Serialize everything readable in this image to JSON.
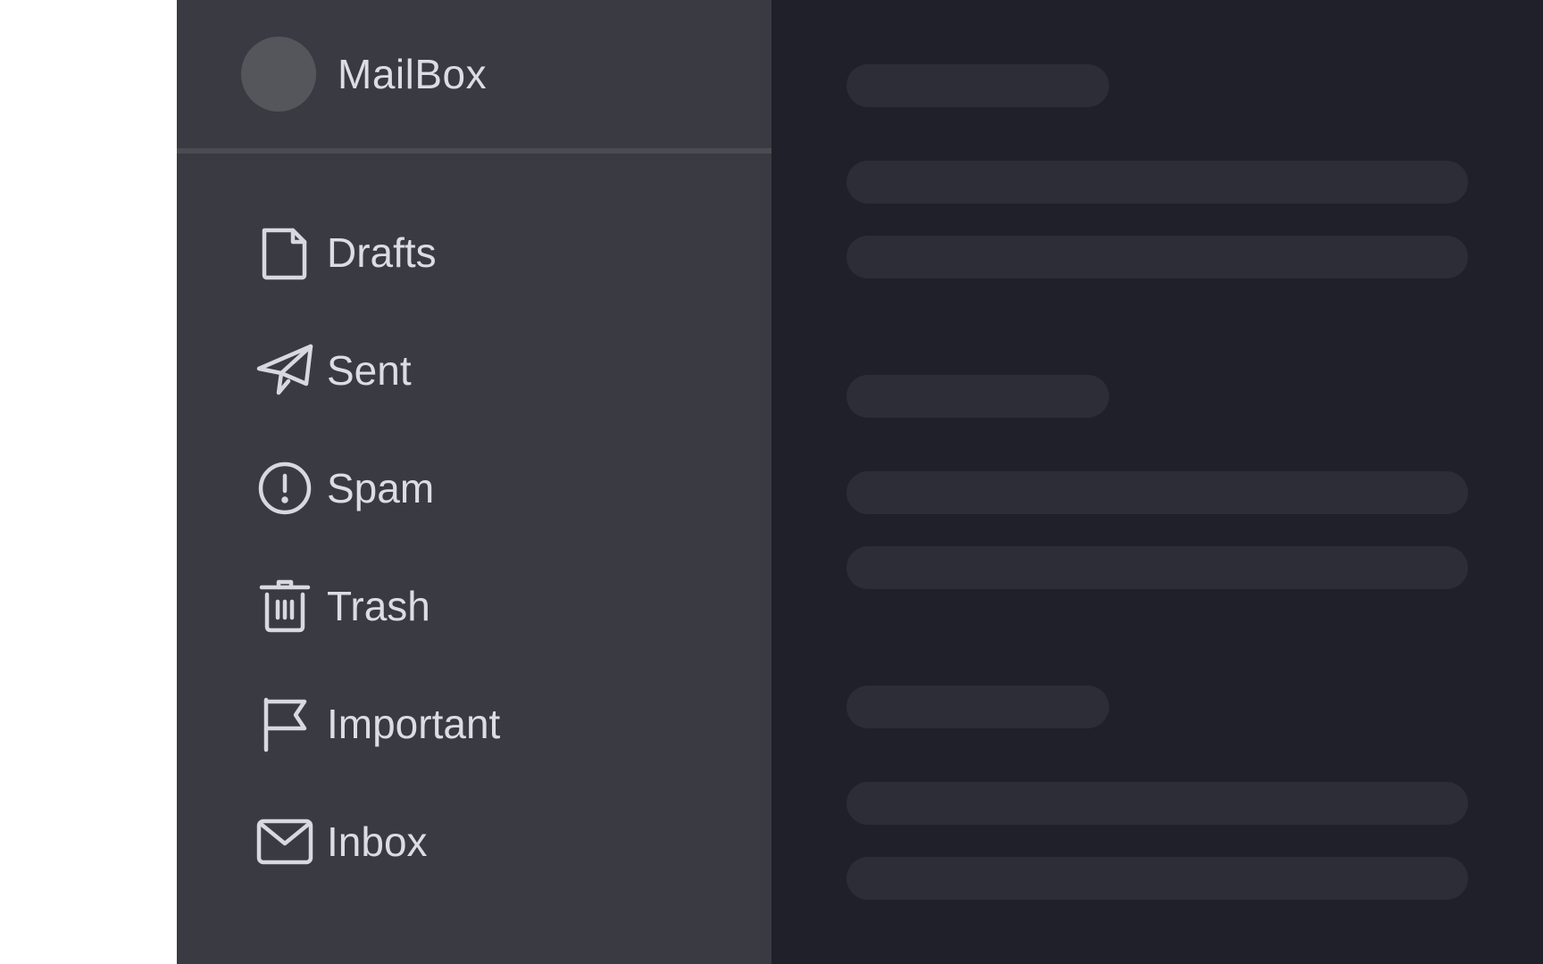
{
  "app": {
    "name": "MailBox"
  },
  "sidebar": {
    "items": [
      {
        "label": "Drafts",
        "icon": "file-icon"
      },
      {
        "label": "Sent",
        "icon": "paper-plane-icon"
      },
      {
        "label": "Spam",
        "icon": "alert-circle-icon"
      },
      {
        "label": "Trash",
        "icon": "trash-icon"
      },
      {
        "label": "Important",
        "icon": "flag-icon"
      },
      {
        "label": "Inbox",
        "icon": "mail-icon"
      }
    ]
  },
  "colors": {
    "sidebar_bg": "#3a3a43",
    "content_bg": "#20202a",
    "skeleton": "#2d2d37",
    "text": "#dcdce2",
    "divider": "#4b4b52"
  }
}
